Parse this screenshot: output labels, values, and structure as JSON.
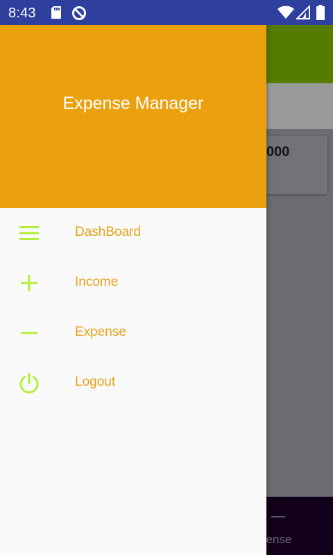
{
  "status_bar": {
    "time": "8:43",
    "icons": [
      "sd-card-icon",
      "data-saver-icon",
      "wifi-icon",
      "signal-icon",
      "battery-icon"
    ]
  },
  "drawer": {
    "title": "Expense Manager",
    "items": [
      {
        "label": "DashBoard",
        "icon": "menu-icon"
      },
      {
        "label": "Income",
        "icon": "plus-icon"
      },
      {
        "label": "Expense",
        "icon": "minus-icon"
      },
      {
        "label": "Logout",
        "icon": "power-icon"
      }
    ]
  },
  "background": {
    "card_amount": "000",
    "bottom_nav_label": "pense"
  },
  "colors": {
    "status_bar": "#2e3f9e",
    "drawer_header": "#eba10e",
    "menu_text": "#e9a116",
    "menu_icon": "#b2ee3c",
    "toolbar": "#557b00"
  }
}
